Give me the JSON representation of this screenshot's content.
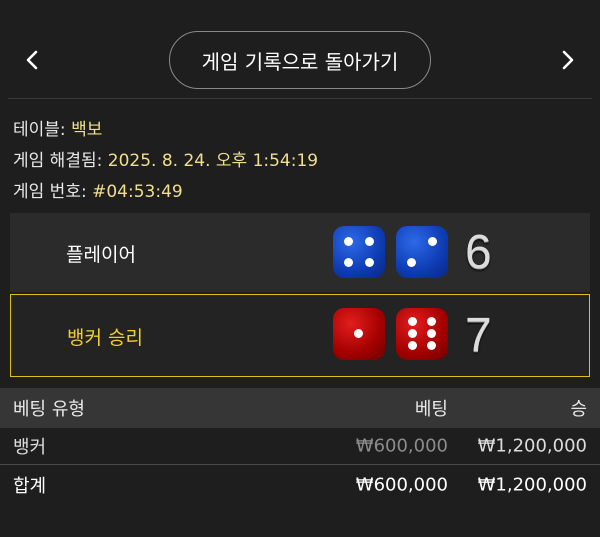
{
  "nav": {
    "prev_icon": "chevron-left-icon",
    "next_icon": "chevron-right-icon"
  },
  "back_button": {
    "label": "게임 기록으로 돌아가기"
  },
  "info": {
    "table_label": "테이블:",
    "table_value": "백보",
    "resolved_label": "게임 해결됨:",
    "resolved_value": "2025. 8. 24. 오후 1:54:19",
    "game_no_label": "게임 번호:",
    "game_no_value": "#04:53:49"
  },
  "rounds": {
    "player": {
      "label": "플레이어",
      "dice": [
        4,
        2
      ],
      "total": "6",
      "color": "#1248d0"
    },
    "banker": {
      "label": "뱅커 승리",
      "dice": [
        1,
        6
      ],
      "total": "7",
      "color": "#b50000",
      "winner": true
    }
  },
  "bets": {
    "headers": {
      "type": "베팅 유형",
      "bet": "베팅",
      "win": "승"
    },
    "rows": [
      {
        "type": "뱅커",
        "bet": "₩600,000",
        "win": "₩1,200,000"
      }
    ],
    "total": {
      "label": "합계",
      "bet": "₩600,000",
      "win": "₩1,200,000"
    }
  },
  "colors": {
    "accent": "#e0bf1c",
    "value": "#f1df8f",
    "background": "#1e1e1e"
  }
}
